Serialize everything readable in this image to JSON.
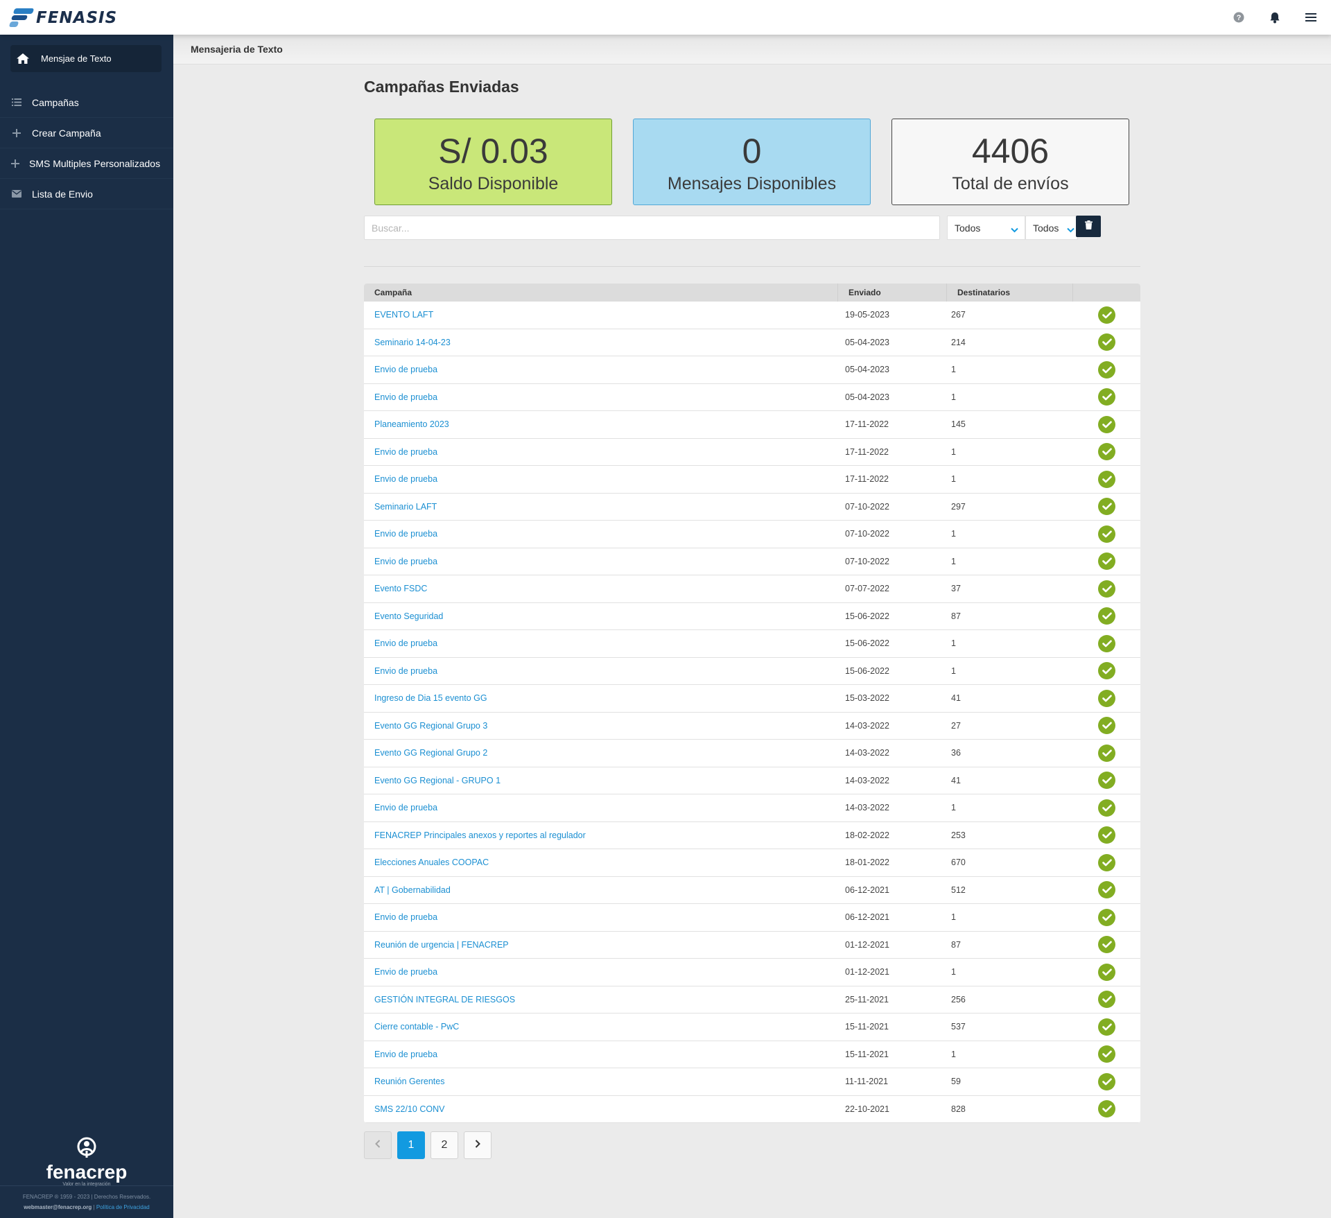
{
  "app": {
    "logo_text": "FENASIS"
  },
  "breadcrumb": "Mensajeria de Texto",
  "sidebar": {
    "home_label": "Mensjae de Texto",
    "items": [
      {
        "label": "Campañas",
        "icon": "list-icon"
      },
      {
        "label": "Crear Campaña",
        "icon": "plus-icon"
      },
      {
        "label": "SMS Multiples Personalizados",
        "icon": "plus-icon"
      },
      {
        "label": "Lista de Envio",
        "icon": "envelope-icon"
      }
    ],
    "brand_name": "fenacrep",
    "brand_tagline": "Valor en la integración",
    "footer_line1": "FENACREP ® 1959 - 2023 | Derechos Reservados.",
    "footer_email": "webmaster@fenacrep.org",
    "footer_sep": "|",
    "footer_privacy": "Política de Privacidad"
  },
  "page": {
    "title": "Campañas Enviadas"
  },
  "stats": [
    {
      "value": "S/ 0.03",
      "label": "Saldo Disponible",
      "color": "#c9e779"
    },
    {
      "value": "0",
      "label": "Mensajes Disponibles",
      "color": "#a8daf1"
    },
    {
      "value": "4406",
      "label": "Total de envíos",
      "color": "#f7f7f7"
    }
  ],
  "filters": {
    "search_placeholder": "Buscar...",
    "select1": "Todos",
    "select2": "Todos"
  },
  "table": {
    "headers": [
      "Campaña",
      "Enviado",
      "Destinatarios",
      ""
    ],
    "rows": [
      {
        "campaign": "EVENTO LAFT",
        "sent": "19-05-2023",
        "recipients": "267"
      },
      {
        "campaign": "Seminario 14-04-23",
        "sent": "05-04-2023",
        "recipients": "214"
      },
      {
        "campaign": "Envio de prueba",
        "sent": "05-04-2023",
        "recipients": "1"
      },
      {
        "campaign": "Envio de prueba",
        "sent": "05-04-2023",
        "recipients": "1"
      },
      {
        "campaign": "Planeamiento 2023",
        "sent": "17-11-2022",
        "recipients": "145"
      },
      {
        "campaign": "Envio de prueba",
        "sent": "17-11-2022",
        "recipients": "1"
      },
      {
        "campaign": "Envio de prueba",
        "sent": "17-11-2022",
        "recipients": "1"
      },
      {
        "campaign": "Seminario LAFT",
        "sent": "07-10-2022",
        "recipients": "297"
      },
      {
        "campaign": "Envio de prueba",
        "sent": "07-10-2022",
        "recipients": "1"
      },
      {
        "campaign": "Envio de prueba",
        "sent": "07-10-2022",
        "recipients": "1"
      },
      {
        "campaign": "Evento FSDC",
        "sent": "07-07-2022",
        "recipients": "37"
      },
      {
        "campaign": "Evento Seguridad",
        "sent": "15-06-2022",
        "recipients": "87"
      },
      {
        "campaign": "Envio de prueba",
        "sent": "15-06-2022",
        "recipients": "1"
      },
      {
        "campaign": "Envio de prueba",
        "sent": "15-06-2022",
        "recipients": "1"
      },
      {
        "campaign": "Ingreso de Dia 15 evento GG",
        "sent": "15-03-2022",
        "recipients": "41"
      },
      {
        "campaign": "Evento GG Regional Grupo 3",
        "sent": "14-03-2022",
        "recipients": "27"
      },
      {
        "campaign": "Evento GG Regional Grupo 2",
        "sent": "14-03-2022",
        "recipients": "36"
      },
      {
        "campaign": "Evento GG Regional - GRUPO 1",
        "sent": "14-03-2022",
        "recipients": "41"
      },
      {
        "campaign": "Envio de prueba",
        "sent": "14-03-2022",
        "recipients": "1"
      },
      {
        "campaign": "FENACREP Principales anexos y reportes al regulador",
        "sent": "18-02-2022",
        "recipients": "253"
      },
      {
        "campaign": "Elecciones Anuales COOPAC",
        "sent": "18-01-2022",
        "recipients": "670"
      },
      {
        "campaign": "AT | Gobernabilidad",
        "sent": "06-12-2021",
        "recipients": "512"
      },
      {
        "campaign": "Envio de prueba",
        "sent": "06-12-2021",
        "recipients": "1"
      },
      {
        "campaign": "Reunión de urgencia | FENACREP",
        "sent": "01-12-2021",
        "recipients": "87"
      },
      {
        "campaign": "Envio de prueba",
        "sent": "01-12-2021",
        "recipients": "1"
      },
      {
        "campaign": "GESTIÓN INTEGRAL DE RIESGOS",
        "sent": "25-11-2021",
        "recipients": "256"
      },
      {
        "campaign": "Cierre contable - PwC",
        "sent": "15-11-2021",
        "recipients": "537"
      },
      {
        "campaign": "Envio de prueba",
        "sent": "15-11-2021",
        "recipients": "1"
      },
      {
        "campaign": "Reunión Gerentes",
        "sent": "11-11-2021",
        "recipients": "59"
      },
      {
        "campaign": "SMS 22/10 CONV",
        "sent": "22-10-2021",
        "recipients": "828"
      }
    ]
  },
  "pagination": {
    "pages": [
      "1",
      "2"
    ],
    "active": "1"
  },
  "colors": {
    "sidebar_bg": "#1b2e46",
    "link": "#1b8fd2",
    "status_ok": "#82ad22",
    "pager_active": "#129ae0"
  }
}
